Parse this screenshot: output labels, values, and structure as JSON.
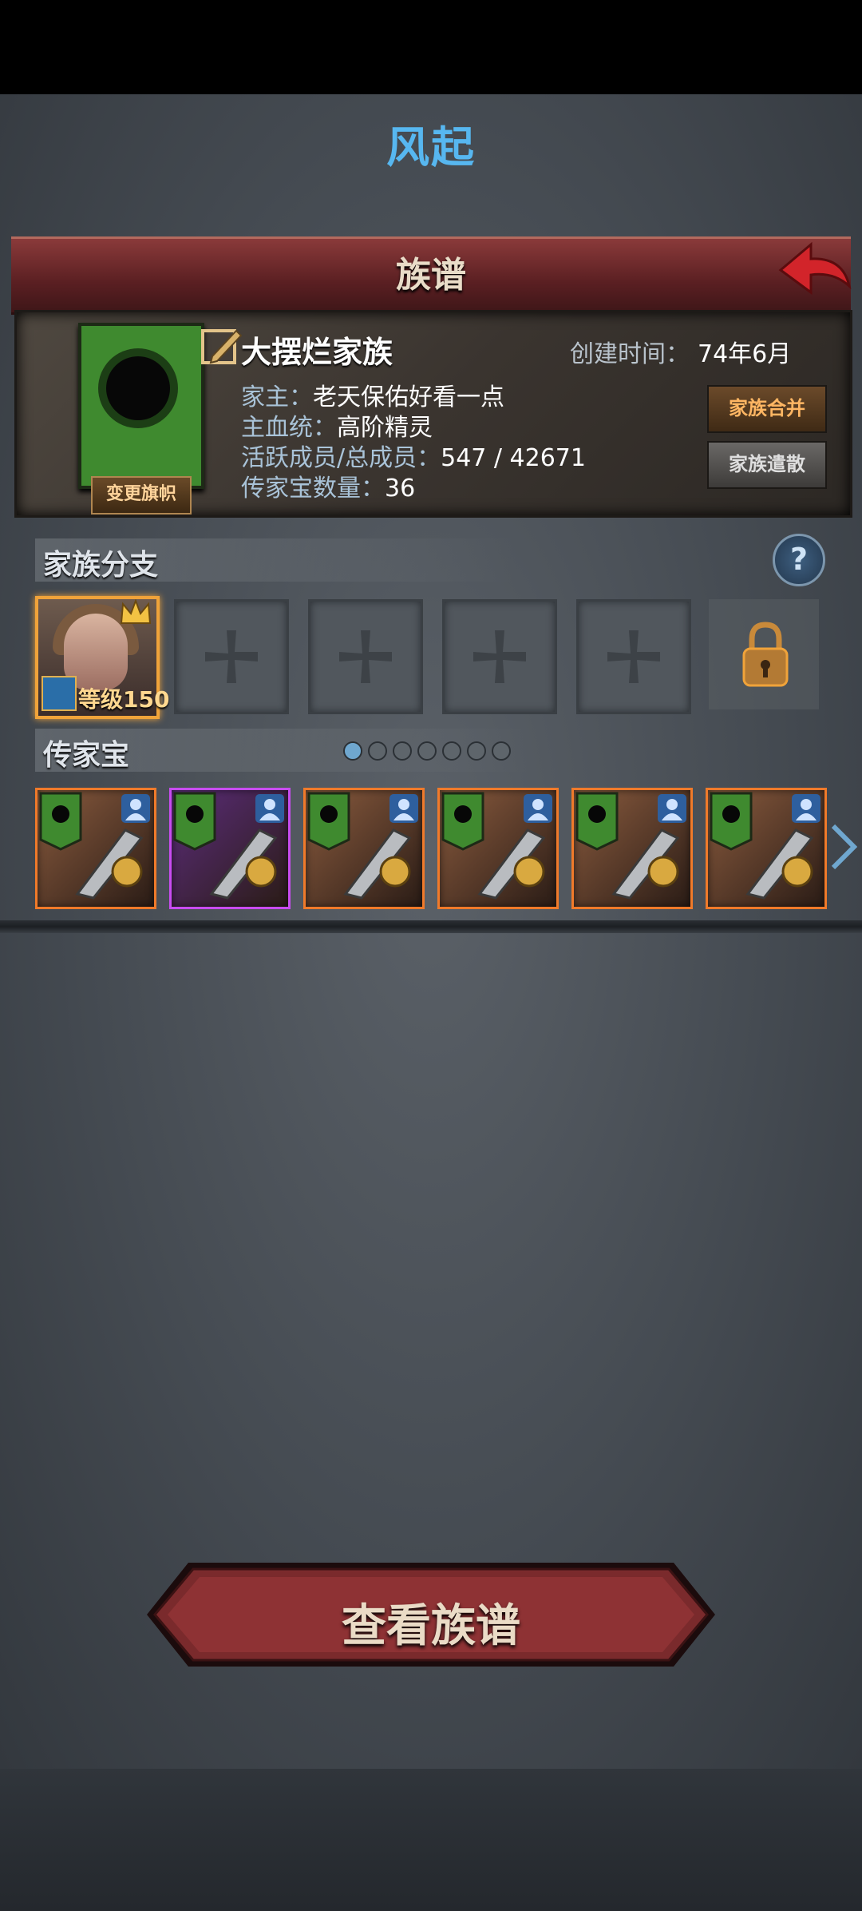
{
  "top_title": "风起",
  "header": {
    "title": "族谱"
  },
  "clan": {
    "name": "大摆烂家族",
    "created_label": "创建时间：",
    "created_value": "74年6月",
    "leader_label": "家主：",
    "leader_value": "老天保佑好看一点",
    "bloodline_label": "主血统：",
    "bloodline_value": "高阶精灵",
    "members_label": "活跃成员/总成员：",
    "members_value": "547 / 42671",
    "heirloom_count_label": "传家宝数量：",
    "heirloom_count_value": "36",
    "change_flag_label": "变更旗帜",
    "merge_label": "家族合并",
    "disband_label": "家族遣散",
    "banner_color": "#3f8a2f"
  },
  "branches": {
    "title": "家族分支",
    "help_symbol": "?",
    "member": {
      "level_text": "等级150"
    },
    "empty_slot_icon": "plus-cross-icon",
    "locked_slot_icon": "padlock-icon"
  },
  "heirlooms": {
    "title": "传家宝",
    "page_count": 7,
    "current_page": 1,
    "items": [
      {
        "rarity": "legendary",
        "icon": "sword-icon",
        "bg": "#8a5b3e"
      },
      {
        "rarity": "epic",
        "icon": "gauntlet-icon",
        "bg": "#5b2c7a"
      },
      {
        "rarity": "legendary",
        "icon": "green-armor-icon",
        "bg": "#8a5b3e"
      },
      {
        "rarity": "legendary",
        "icon": "gold-shield-icon",
        "bg": "#8a5b3e"
      },
      {
        "rarity": "legendary",
        "icon": "gold-armor-icon",
        "bg": "#8a5b3e"
      },
      {
        "rarity": "legendary",
        "icon": "silver-armor-icon",
        "bg": "#8a5b3e"
      }
    ]
  },
  "footer": {
    "view_button_label": "查看族谱"
  },
  "colors": {
    "accent_blue": "#57b7f0",
    "legendary_border": "#f07a2a",
    "epic_border": "#c84cf0"
  }
}
